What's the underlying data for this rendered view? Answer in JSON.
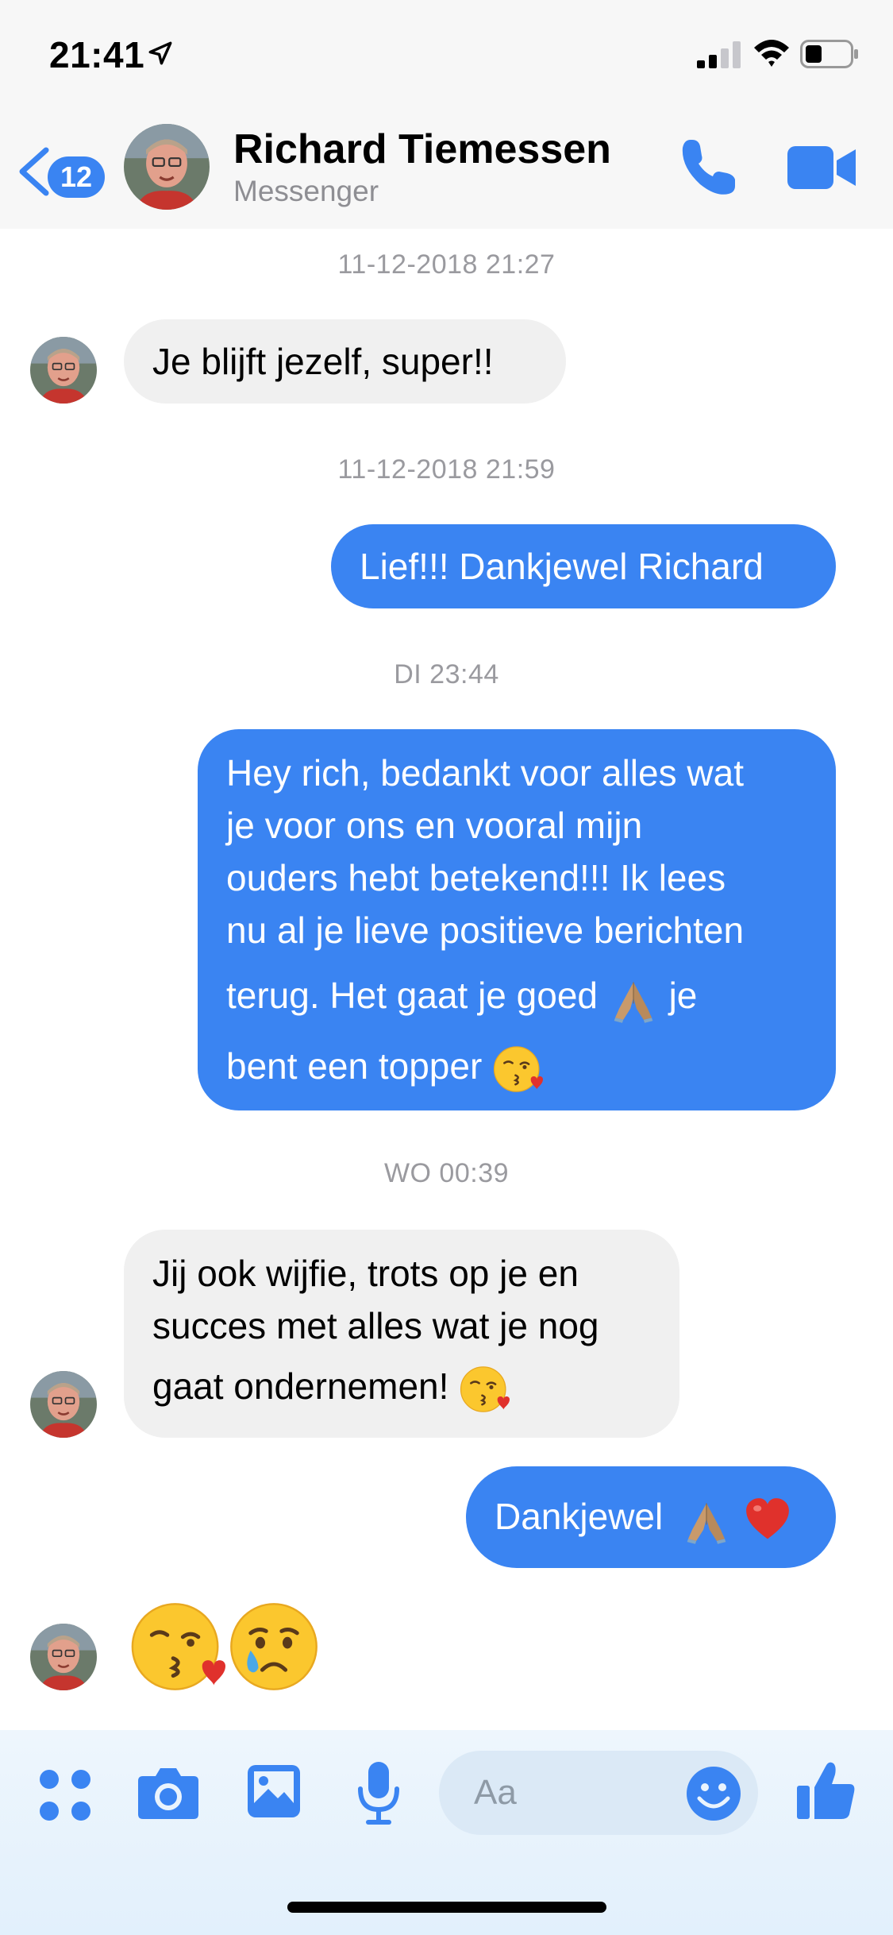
{
  "status_bar": {
    "time": "21:41",
    "icons": [
      "location-arrow-icon",
      "signal-icon",
      "wifi-icon",
      "battery-icon"
    ]
  },
  "header": {
    "back_badge": "12",
    "contact_name": "Richard Tiemessen",
    "subtitle": "Messenger",
    "icons": [
      "back-chevron-icon",
      "phone-icon",
      "video-camera-icon"
    ]
  },
  "colors": {
    "accent": "#3a84f2",
    "incoming_bubble": "#f0f0f0",
    "timestamp": "#9a9a9f"
  },
  "messages": [
    {
      "type": "timestamp",
      "text": "11-12-2018 21:27"
    },
    {
      "type": "incoming",
      "text": "Je blijft jezelf, super!!"
    },
    {
      "type": "timestamp",
      "text": "11-12-2018 21:59"
    },
    {
      "type": "outgoing",
      "text": "Lief!!! Dankjewel Richard"
    },
    {
      "type": "timestamp",
      "text": "DI 23:44"
    },
    {
      "type": "outgoing",
      "lines": [
        "Hey rich, bedankt voor alles wat",
        "je voor ons en vooral mijn",
        "ouders hebt betekend!!! Ik lees",
        "nu al je lieve positieve berichten",
        "terug. Het gaat je goed",
        "je",
        "bent een topper"
      ],
      "emojis": [
        "folded-hands-emoji",
        "kissing-heart-emoji"
      ]
    },
    {
      "type": "timestamp",
      "text": "WO 00:39"
    },
    {
      "type": "incoming",
      "lines": [
        "Jij ook wijfie, trots op je en",
        "succes met alles wat je nog",
        "gaat ondernemen!"
      ],
      "emojis": [
        "kissing-heart-emoji"
      ]
    },
    {
      "type": "outgoing",
      "text": "Dankjewel",
      "emojis": [
        "folded-hands-emoji",
        "red-heart-emoji"
      ]
    },
    {
      "type": "incoming",
      "emojis": [
        "kissing-heart-emoji",
        "crying-face-emoji"
      ]
    }
  ],
  "composer": {
    "placeholder": "Aa",
    "tools": [
      "more-apps-icon",
      "camera-icon",
      "gallery-icon",
      "microphone-icon",
      "emoji-icon",
      "thumbs-up-icon"
    ]
  }
}
